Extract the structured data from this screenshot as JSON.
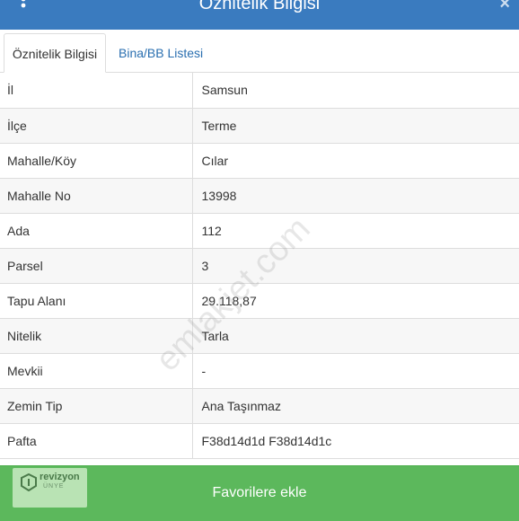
{
  "header": {
    "title": "Öznitelik Bilgisi",
    "close_symbol": "×",
    "menu_icon": "more-vertical-icon",
    "close_icon": "close-icon"
  },
  "tabs": [
    {
      "label": "Öznitelik Bilgisi",
      "active": true
    },
    {
      "label": "Bina/BB Listesi",
      "active": false
    }
  ],
  "table": {
    "rows": [
      {
        "key": "İl",
        "value": "Samsun"
      },
      {
        "key": "İlçe",
        "value": "Terme"
      },
      {
        "key": "Mahalle/Köy",
        "value": "Cılar"
      },
      {
        "key": "Mahalle No",
        "value": "13998"
      },
      {
        "key": "Ada",
        "value": "112"
      },
      {
        "key": "Parsel",
        "value": "3"
      },
      {
        "key": "Tapu Alanı",
        "value": "29.118,87"
      },
      {
        "key": "Nitelik",
        "value": "Tarla"
      },
      {
        "key": "Mevkii",
        "value": "-"
      },
      {
        "key": "Zemin Tip",
        "value": "Ana Taşınmaz"
      },
      {
        "key": "Pafta",
        "value": "F38d14d1d F38d14d1c"
      }
    ]
  },
  "watermark": {
    "text": "emlakjet.com"
  },
  "footer": {
    "button_label": "Favorilere ekle"
  },
  "logo": {
    "text": "revizyon",
    "sub": "ÜNYE"
  },
  "colors": {
    "header": "#3a7bbf",
    "footer": "#5cb85c",
    "link": "#2a6fb0"
  }
}
